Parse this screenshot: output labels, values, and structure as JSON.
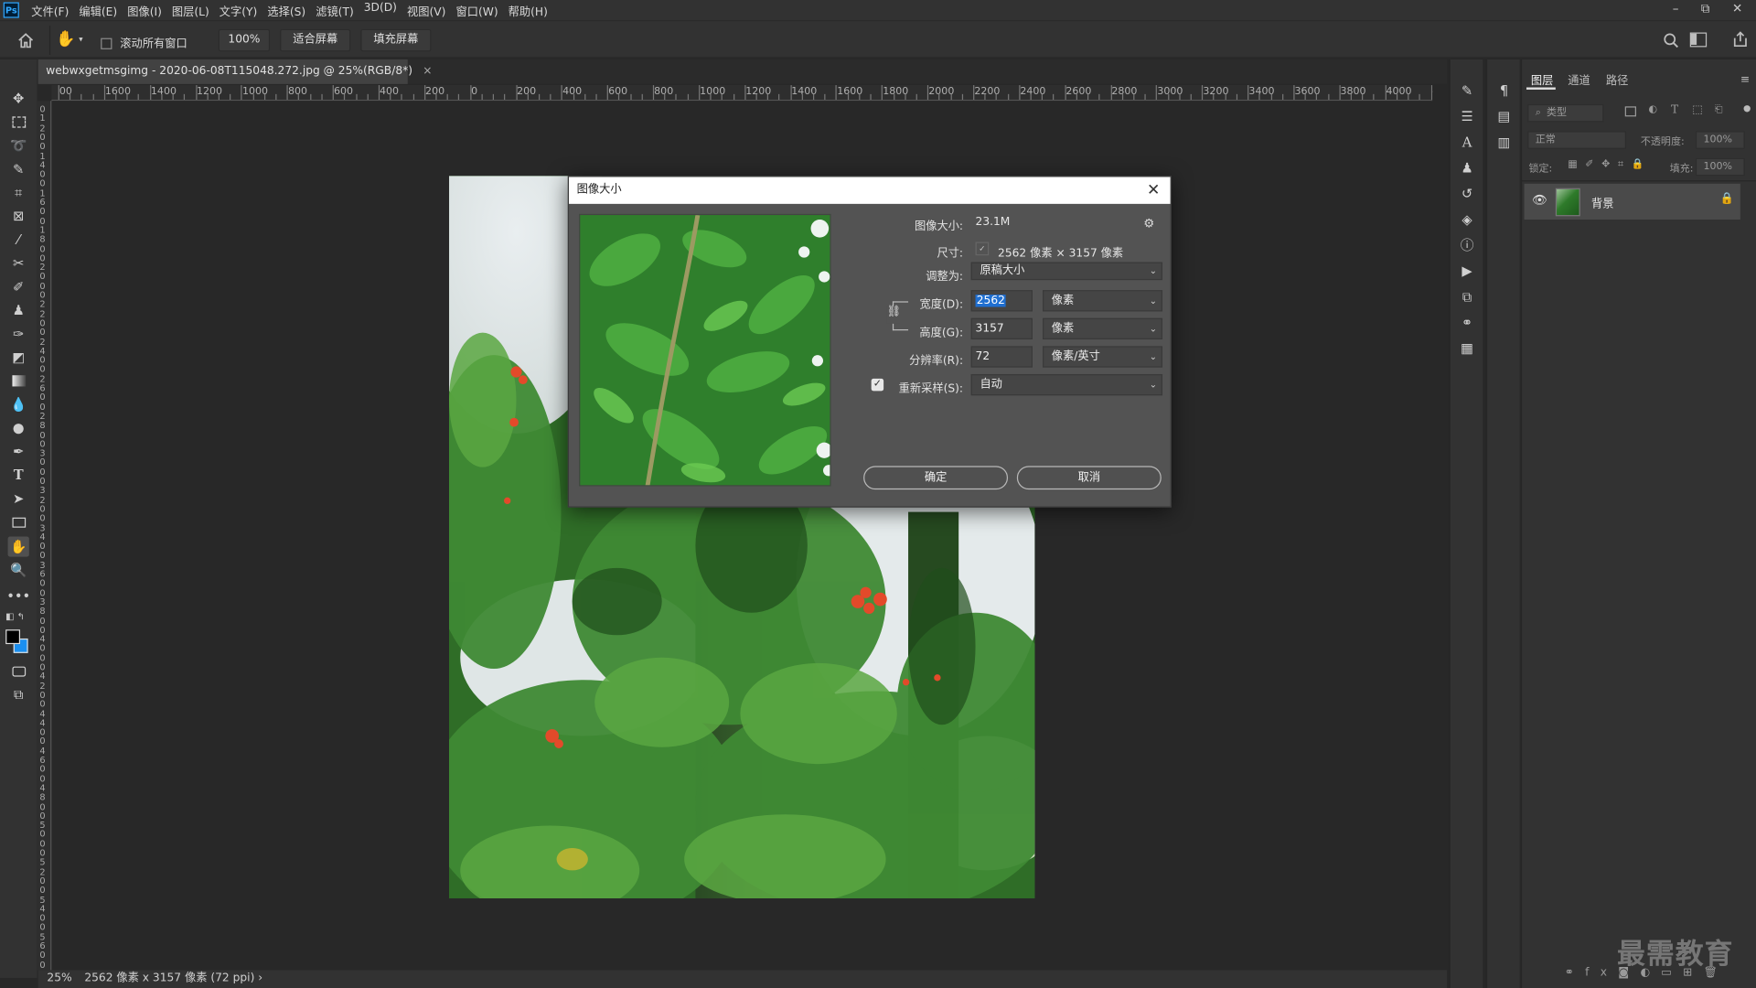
{
  "menubar": {
    "app_logo": "Ps",
    "menus": [
      "文件(F)",
      "编辑(E)",
      "图像(I)",
      "图层(L)",
      "文字(Y)",
      "选择(S)",
      "滤镜(T)",
      "3D(D)",
      "视图(V)",
      "窗口(W)",
      "帮助(H)"
    ],
    "window_controls": [
      "–",
      "⧉",
      "✕"
    ]
  },
  "options": {
    "scroll_all_label": "滚动所有窗口",
    "zoom_value": "100%",
    "fit_screen_label": "适合屏幕",
    "fill_screen_label": "填充屏幕"
  },
  "document": {
    "tab_title": "webwxgetmsgimg - 2020-06-08T115048.272.jpg @ 25%(RGB/8*)",
    "tab_close": "×"
  },
  "ruler": {
    "h_labels": [
      "00",
      "1600",
      "1400",
      "1200",
      "1000",
      "800",
      "600",
      "400",
      "200",
      "0",
      "200",
      "400",
      "600",
      "800",
      "1000",
      "1200",
      "1400",
      "1600",
      "1800",
      "2000",
      "2200",
      "2400",
      "2600",
      "2800",
      "3000",
      "3200",
      "3400",
      "3600",
      "3800",
      "4000",
      "420"
    ]
  },
  "status": {
    "zoom": "25%",
    "info": "2562 像素 x 3157 像素 (72 ppi)",
    "arrow": "›"
  },
  "dialog": {
    "title": "图像大小",
    "close": "✕",
    "image_size_label": "图像大小:",
    "image_size_value": "23.1M",
    "settings_icon": "⚙",
    "dimensions_label": "尺寸:",
    "dimensions_value": "2562 像素  ×  3157 像素",
    "fit_to_label": "调整为:",
    "fit_to_value": "原稿大小",
    "width_label": "宽度(D):",
    "width_value": "2562",
    "width_unit": "像素",
    "height_label": "高度(G):",
    "height_value": "3157",
    "height_unit": "像素",
    "resolution_label": "分辨率(R):",
    "resolution_value": "72",
    "resolution_unit": "像素/英寸",
    "resample_label": "重新采样(S):",
    "resample_value": "自动",
    "resample_checked": true,
    "ok_label": "确定",
    "cancel_label": "取消"
  },
  "layers_panel": {
    "tabs": [
      "图层",
      "通道",
      "路径"
    ],
    "filter_placeholder": "类型",
    "blend_mode": "正常",
    "opacity_label": "不透明度:",
    "opacity_value": "100%",
    "lock_label": "锁定:",
    "fill_label": "填充:",
    "fill_value": "100%",
    "layer_name": "背景"
  },
  "watermark": "最需教育"
}
